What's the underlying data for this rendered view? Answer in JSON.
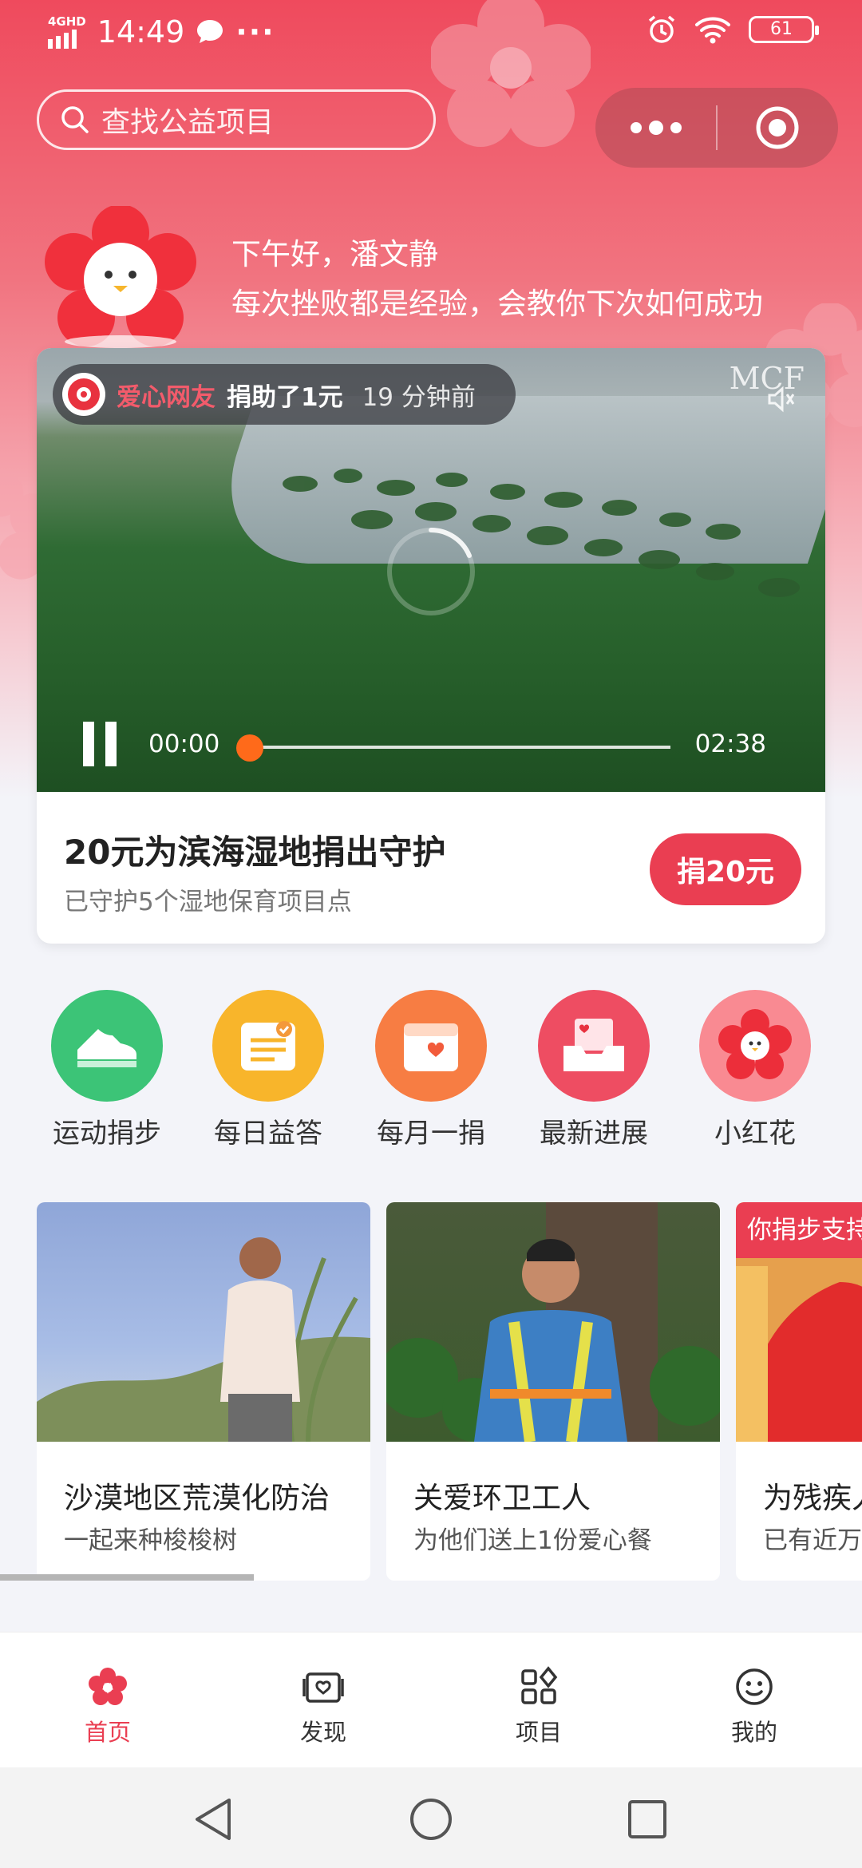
{
  "status_bar": {
    "network": "4GHD",
    "time": "14:49",
    "battery": "61"
  },
  "search": {
    "placeholder": "查找公益项目"
  },
  "greeting": {
    "title": "下午好，潘文静",
    "motto": "每次挫败都是经验，会教你下次如何成功"
  },
  "featured": {
    "donor_name": "爱心网友",
    "donor_action": "捐助了1元",
    "donor_time": "19 分钟前",
    "brand_logo": "MCF",
    "video": {
      "current_time": "00:00",
      "total_time": "02:38",
      "progress": 0
    },
    "title": "20元为滨海湿地捐出守护",
    "subtitle": "已守护5个湿地保育项目点",
    "donate_label": "捐20元"
  },
  "quick_entries": [
    {
      "label": "运动捐步",
      "icon": "sneaker-icon",
      "color": "#3cc477"
    },
    {
      "label": "每日益答",
      "icon": "quiz-card-icon",
      "color": "#f8b52b"
    },
    {
      "label": "每月一捐",
      "icon": "calendar-heart-icon",
      "color": "#f77d43"
    },
    {
      "label": "最新进展",
      "icon": "inbox-heart-icon",
      "color": "#ee4d62"
    },
    {
      "label": "小红花",
      "icon": "red-flower-icon",
      "color": "#f98a92"
    }
  ],
  "projects": [
    {
      "title": "沙漠地区荒漠化防治",
      "subtitle": "一起来种梭梭树"
    },
    {
      "title": "关爱环卫工人",
      "subtitle": "为他们送上1份爱心餐"
    },
    {
      "title": "为残疾人",
      "subtitle": "已有近万",
      "badge": "你捐步支持"
    }
  ],
  "tabbar": [
    {
      "label": "首页",
      "icon": "flower-home-icon",
      "active": true
    },
    {
      "label": "发现",
      "icon": "discover-icon",
      "active": false
    },
    {
      "label": "项目",
      "icon": "grid-projects-icon",
      "active": false
    },
    {
      "label": "我的",
      "icon": "smiley-profile-icon",
      "active": false
    }
  ],
  "colors": {
    "brand_red": "#ea3e52",
    "progress_knob": "#ff6a1a"
  }
}
